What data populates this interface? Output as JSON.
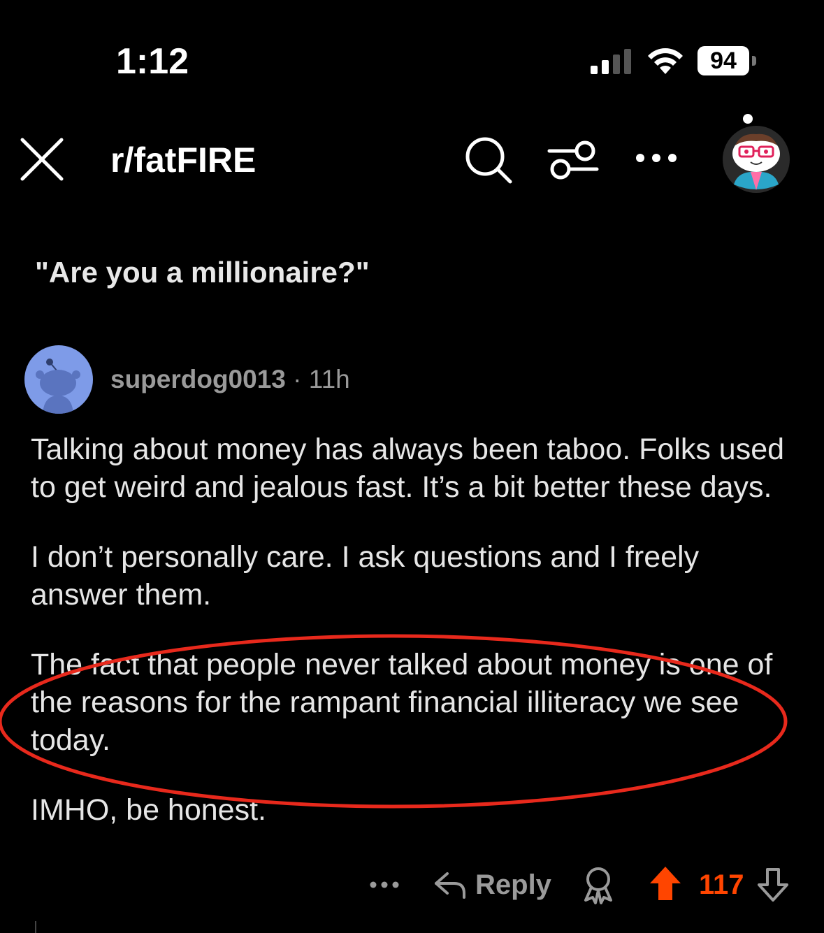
{
  "status_bar": {
    "time": "1:12",
    "battery_level": "94"
  },
  "header": {
    "subreddit": "r/fatFIRE"
  },
  "post": {
    "title": "\"Are you a millionaire?\""
  },
  "comment": {
    "author": "superdog0013",
    "separator": "·",
    "age": "11h",
    "paragraphs": [
      "Talking about money has always been taboo. Folks used to get weird and jealous fast. It’s a bit better these days.",
      "I don’t personally care. I ask questions and I freely answer them.",
      "The fact that people never talked about money is one of the reasons for the rampant financial illiteracy we see today.",
      "IMHO, be honest."
    ],
    "actions": {
      "reply_label": "Reply",
      "vote_count": "117"
    }
  },
  "colors": {
    "background": "#000000",
    "upvote_active": "#ff4500",
    "highlight_ring": "#e8291c",
    "avatar_bg": "#7e9be8"
  },
  "icons": [
    "close-icon",
    "search-icon",
    "filter-icon",
    "more-icon",
    "user-avatar",
    "reply-icon",
    "award-icon",
    "upvote-icon",
    "downvote-icon"
  ]
}
